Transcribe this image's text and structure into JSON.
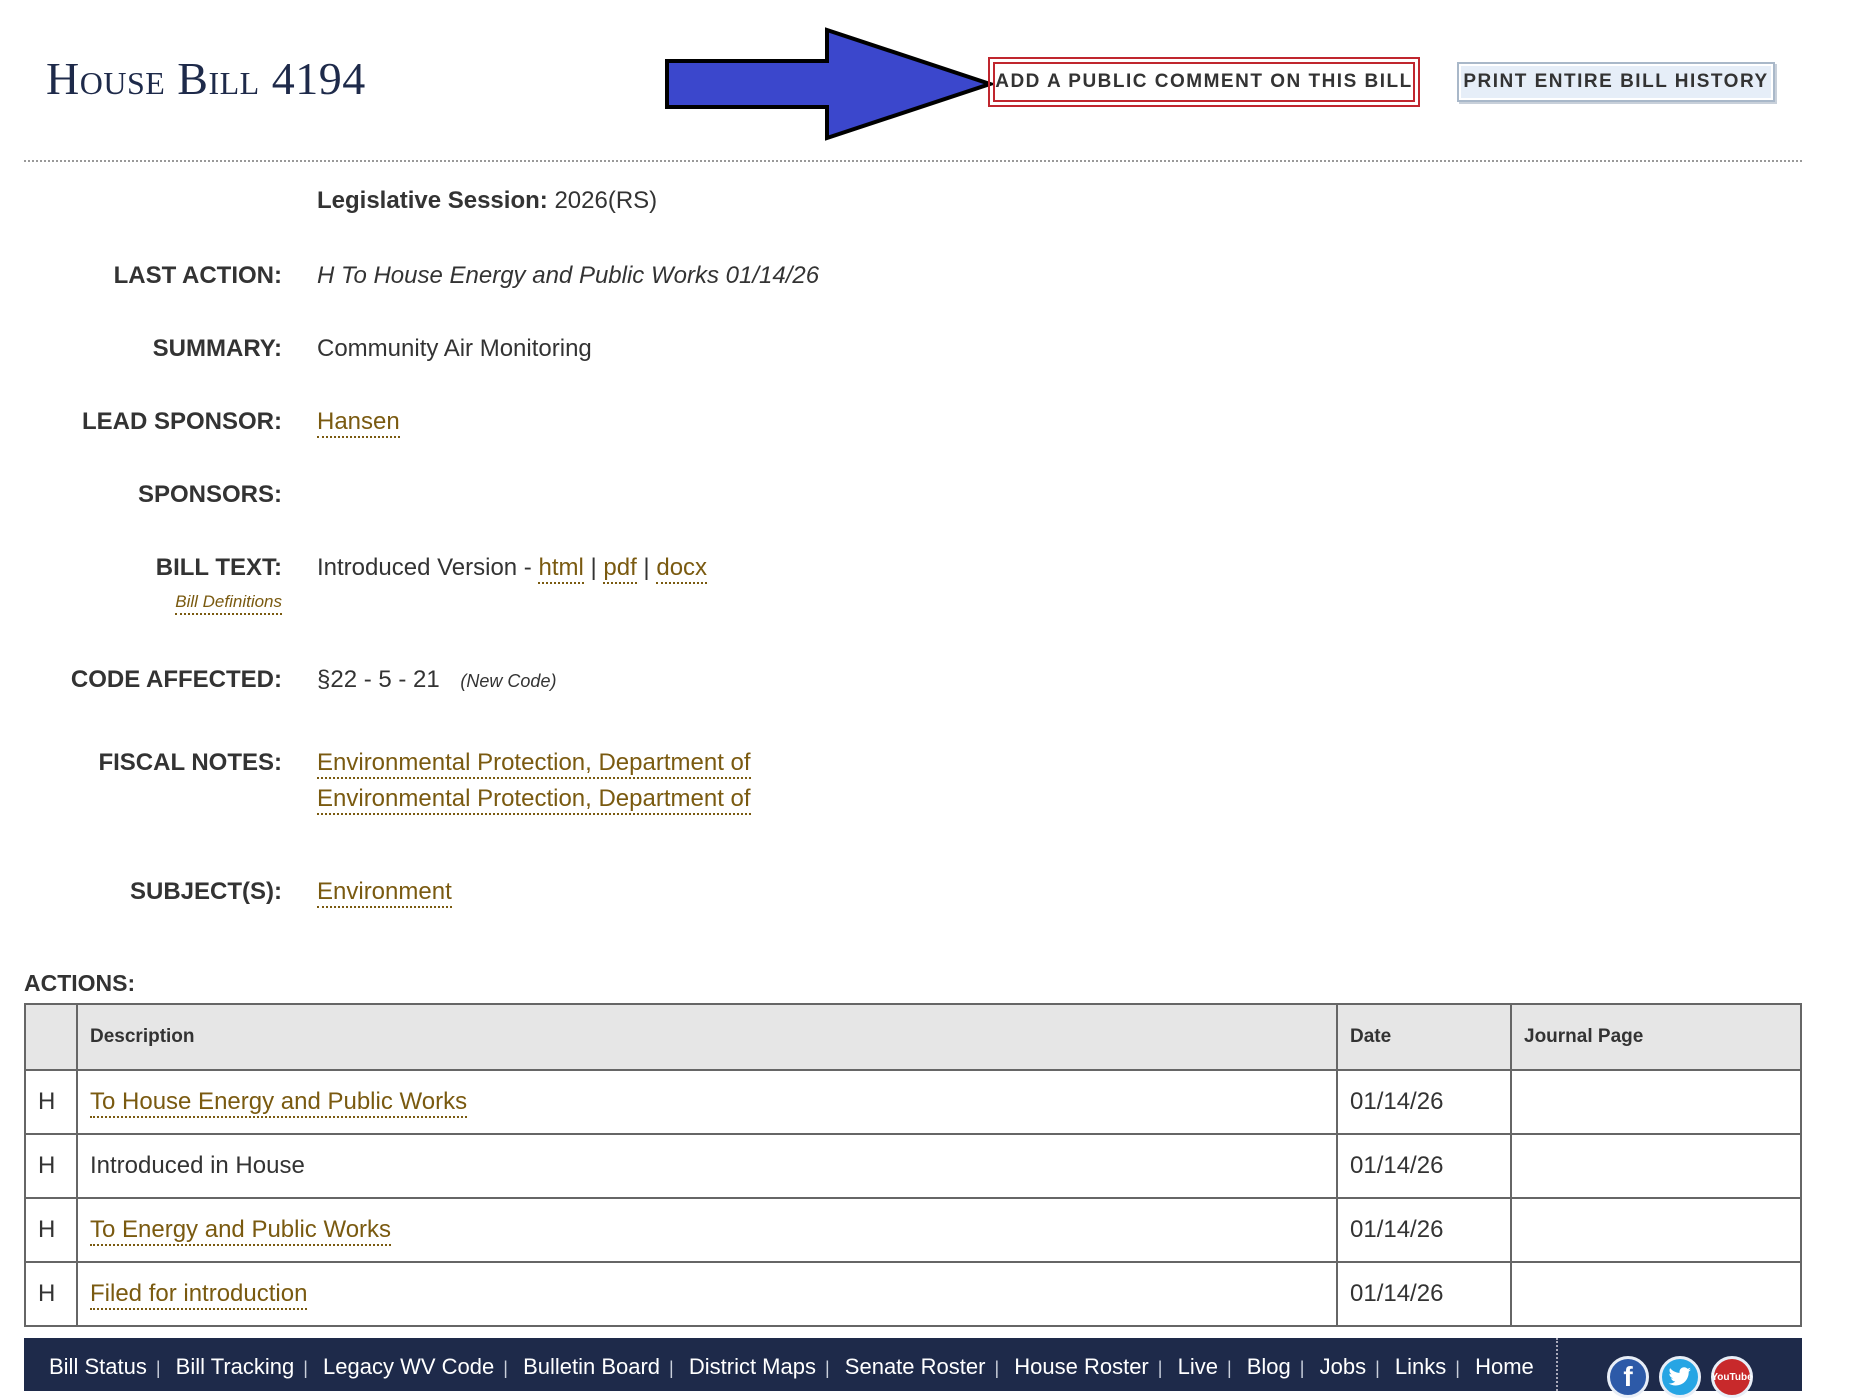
{
  "header": {
    "title": "House Bill 4194",
    "add_comment_label": "ADD A PUBLIC COMMENT ON THIS BILL",
    "print_history_label": "PRINT ENTIRE BILL HISTORY",
    "arrow_color": "#3b47cc"
  },
  "details": {
    "session_label": "Legislative Session:",
    "session_value": "2026(RS)",
    "last_action_label": "LAST ACTION:",
    "last_action_value": "H To House Energy and Public Works 01/14/26",
    "summary_label": "SUMMARY:",
    "summary_value": "Community Air Monitoring",
    "lead_sponsor_label": "LEAD SPONSOR:",
    "lead_sponsor_value": "Hansen",
    "sponsors_label": "SPONSORS:",
    "bill_text_label": "BILL TEXT:",
    "bill_definitions_link": "Bill Definitions",
    "introduced_version": "Introduced Version -",
    "html_link": "html",
    "pdf_link": "pdf",
    "docx_link": "docx",
    "code_affected_label": "CODE AFFECTED:",
    "code_affected_value": "§22 - 5 - 21",
    "code_affected_note": "(New Code)",
    "fiscal_notes_label": "FISCAL NOTES:",
    "fiscal_notes": [
      "Environmental Protection, Department of",
      "Environmental Protection, Department of"
    ],
    "subjects_label": "SUBJECT(S):",
    "subjects_value": "Environment"
  },
  "actions": {
    "label": "ACTIONS:",
    "headers": {
      "chamber": "",
      "description": "Description",
      "date": "Date",
      "journal_page": "Journal Page"
    },
    "rows": [
      {
        "chamber": "H",
        "description": "To House Energy and Public Works",
        "link": true,
        "date": "01/14/26",
        "journal_page": ""
      },
      {
        "chamber": "H",
        "description": "Introduced in House",
        "link": false,
        "date": "01/14/26",
        "journal_page": ""
      },
      {
        "chamber": "H",
        "description": "To Energy and Public Works",
        "link": true,
        "date": "01/14/26",
        "journal_page": ""
      },
      {
        "chamber": "H",
        "description": "Filed for introduction",
        "link": true,
        "date": "01/14/26",
        "journal_page": ""
      }
    ]
  },
  "footer": {
    "links": [
      "Bill Status",
      "Bill Tracking",
      "Legacy WV Code",
      "Bulletin Board",
      "District Maps",
      "Senate Roster",
      "House Roster",
      "Live",
      "Blog",
      "Jobs",
      "Links",
      "Home"
    ],
    "social": {
      "facebook": "f",
      "twitter": "twitter-bird-icon",
      "youtube": "YouTube"
    }
  }
}
